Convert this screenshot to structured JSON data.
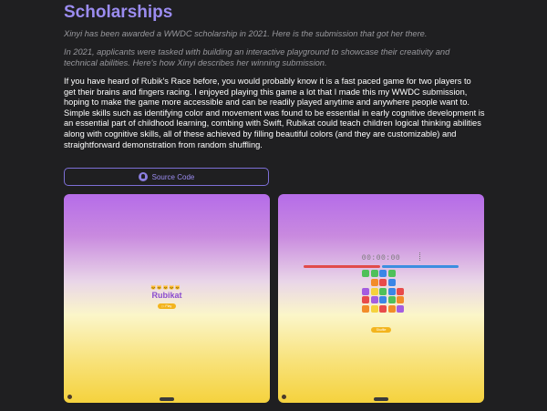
{
  "section": {
    "title": "Scholarships",
    "intro": "Xinyi has been awarded a WWDC scholarship in 2021. Here is the submission that got her there.",
    "intro2": "In 2021, applicants were tasked with building an interactive playground to showcase their creativity and technical abilities. Here's how Xinyi describes her winning submission.",
    "body": "If you have heard of Rubik's Race before, you would probably know it is a fast paced game for two players to get their brains and fingers racing. I enjoyed playing this game a lot that I made this my WWDC submission, hoping to make the game more accessible and can be readily played anytime and anywhere people want to. Simple skills such as identifying color and movement was found to be essential in early cognitive development is an essential part of childhood learning, combing with Swift, Rubikat could teach children logical thinking abilities along with cognitive skills, all of these achieved by filling beautiful colors (and they are customizable) and straightforward demonstration from random shuffling."
  },
  "source_button": {
    "label": "Source Code",
    "icon": "github-icon"
  },
  "screenshots": {
    "left": {
      "app_title": "Rubikat",
      "emojis": "🐱🐱🐱🐱🐱",
      "play_label": "▷ Play"
    },
    "right": {
      "timer": "00:00:00",
      "shuffle_label": "Shuffle"
    }
  },
  "colors": {
    "accent": "#9b8cf0",
    "background": "#1f1f21",
    "muted_text": "#98989d"
  }
}
